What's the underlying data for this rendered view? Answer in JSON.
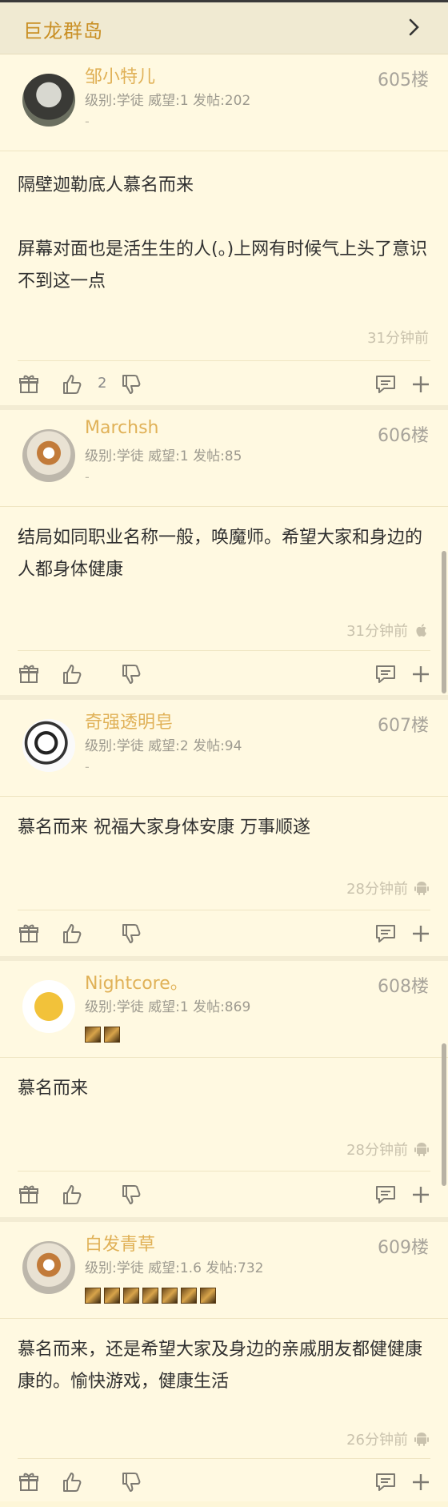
{
  "header": {
    "title": "巨龙群岛"
  },
  "posts": [
    {
      "name": "邹小特儿",
      "meta": "级别:学徒 威望:1 发帖:202",
      "sub": "-",
      "floor": "605楼",
      "content": "隔壁迦勒底人慕名而来\n\n屏幕对面也是活生生的人(。)上网有时候气上头了意识不到这一点",
      "time": "31分钟前",
      "platform": "",
      "likes": "2"
    },
    {
      "name": "Marchsh",
      "meta": "级别:学徒 威望:1 发帖:85",
      "sub": "-",
      "floor": "606楼",
      "content": "结局如同职业名称一般，唤魔师。希望大家和身边的人都身体健康",
      "time": "31分钟前",
      "platform": "apple-icon",
      "likes": ""
    },
    {
      "name": "奇强透明皂",
      "meta": "级别:学徒 威望:2 发帖:94",
      "sub": "-",
      "floor": "607楼",
      "content": "慕名而来 祝福大家身体安康 万事顺遂",
      "time": "28分钟前",
      "platform": "android-icon",
      "likes": ""
    },
    {
      "name": "Nightcore。",
      "meta": "级别:学徒 威望:1 发帖:869",
      "sub": "",
      "floor": "608楼",
      "content": "慕名而来",
      "time": "28分钟前",
      "platform": "android-icon",
      "likes": ""
    },
    {
      "name": "白发青草",
      "meta": "级别:学徒 威望:1.6 发帖:732",
      "sub": "",
      "floor": "609楼",
      "content": "慕名而来，还是希望大家及身边的亲戚朋友都健健康康的。愉快游戏，健康生活",
      "time": "26分钟前",
      "platform": "android-icon",
      "likes": ""
    }
  ],
  "colors": {
    "accent": "#c98f24",
    "username": "#e0b157",
    "background": "#fff9e1"
  }
}
